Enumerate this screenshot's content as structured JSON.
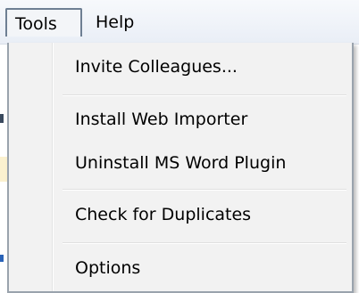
{
  "menubar": {
    "items": [
      {
        "label": "Tools"
      },
      {
        "label": "Help"
      }
    ]
  },
  "tools_menu": {
    "items": [
      {
        "label": "Invite Colleagues..."
      },
      {
        "label": "Install Web Importer"
      },
      {
        "label": "Uninstall MS Word Plugin"
      },
      {
        "label": "Check for Duplicates"
      },
      {
        "label": "Options"
      }
    ]
  }
}
